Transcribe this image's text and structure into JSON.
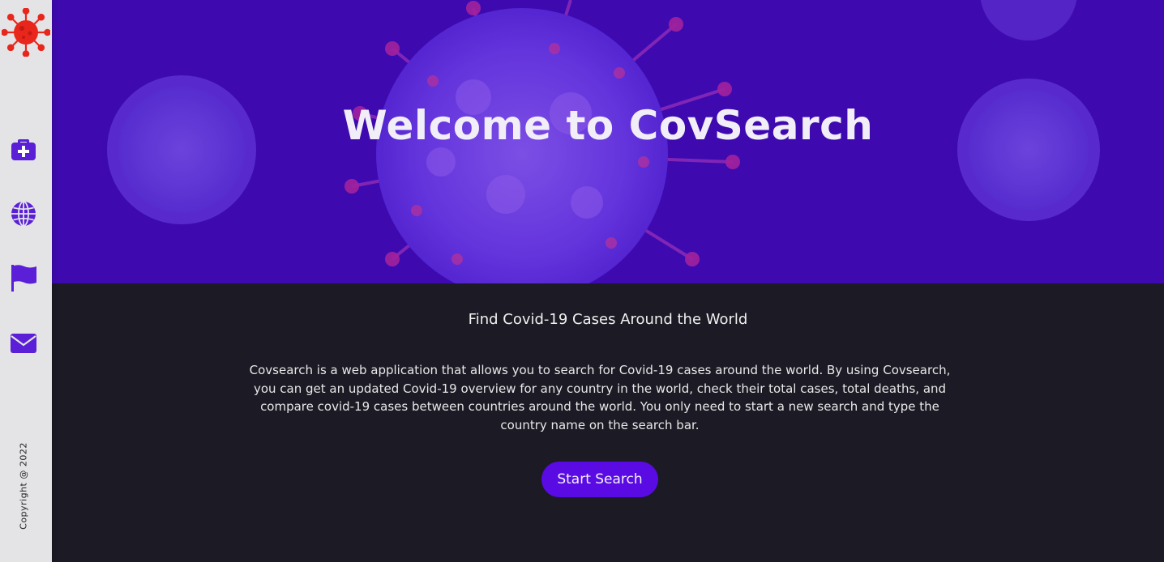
{
  "sidebar": {
    "logo_icon": "virus-icon",
    "logo_color": "#e8261c",
    "icon_color": "#5a1fd6",
    "items": [
      {
        "icon": "medical-kit-icon"
      },
      {
        "icon": "globe-icon"
      },
      {
        "icon": "flag-icon"
      },
      {
        "icon": "envelope-icon"
      }
    ],
    "copyright": "Copyright @ 2022"
  },
  "hero": {
    "title": "Welcome to CovSearch",
    "background_color": "#3f0ab0",
    "background_image": "virus-illustration"
  },
  "content": {
    "subtitle": "Find Covid-19 Cases Around the World",
    "description": "Covsearch is a web application that allows you to search for Covid-19 cases around the world. By using Covsearch, you can get an updated Covid-19 overview for any country in the world, check their total cases, total deaths, and compare covid-19 cases between countries around the world. You only need to start a new search and type the country name on the search bar.",
    "start_button_label": "Start Search",
    "accent_color": "#5a0be4",
    "background_color": "#1b1a25"
  }
}
